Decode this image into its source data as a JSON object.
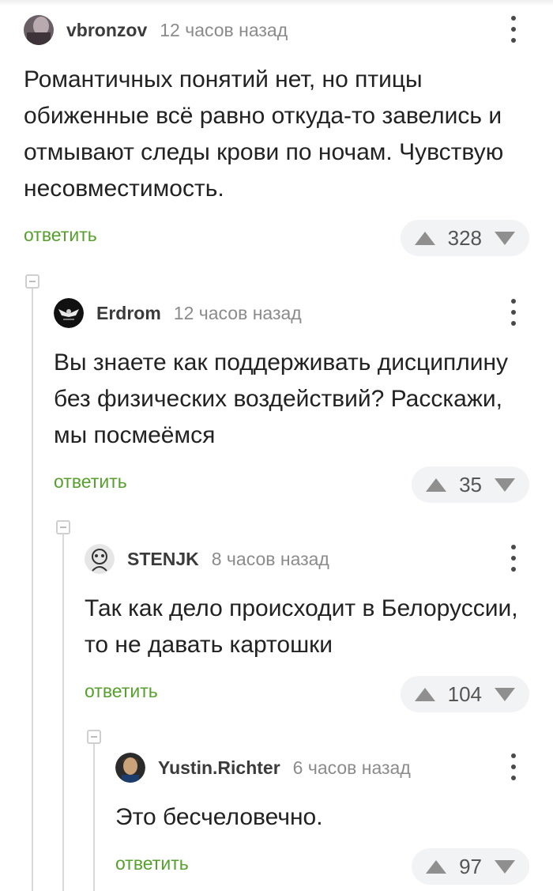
{
  "comments": [
    {
      "author": "vbronzov",
      "time": "12 часов назад",
      "text": "Романтичных понятий нет, но птицы обиженные всё равно откуда-то завелись и отмывают следы крови по ночам. Чувствую несовместимость.",
      "reply": "ответить",
      "score": "328"
    },
    {
      "author": "Erdrom",
      "time": "12 часов назад",
      "text": "Вы знаете как поддерживать дисциплину без физических воздействий? Расскажи, мы посмеёмся",
      "reply": "ответить",
      "score": "35"
    },
    {
      "author": "STENJK",
      "time": "8 часов назад",
      "text": "Так как дело происходит в Белоруссии, то не давать картошки",
      "reply": "ответить",
      "score": "104"
    },
    {
      "author": "Yustin.Richter",
      "time": "6 часов назад",
      "text": "Это бесчеловечно.",
      "reply": "ответить",
      "score": "97"
    }
  ],
  "colors": {
    "reply_link": "#55a12b",
    "vote_pill": "#f2f3f5",
    "thread_line": "#d9d9d9"
  },
  "icons": [
    "avatar",
    "kebab-menu-icon",
    "upvote-icon",
    "downvote-icon",
    "collapse-thread-icon"
  ]
}
